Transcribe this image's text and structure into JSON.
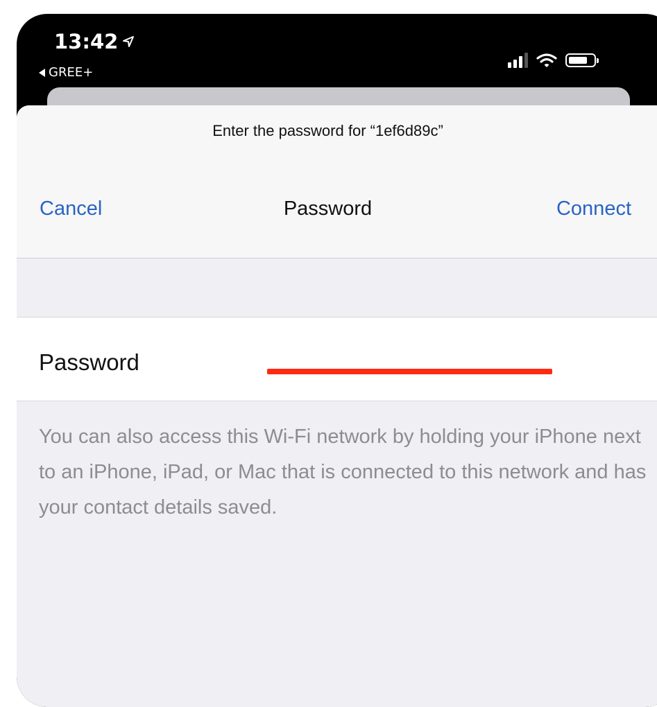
{
  "status_bar": {
    "time": "13:42",
    "location_glyph": "➤",
    "back_app": "GREE+"
  },
  "sheet": {
    "prompt": "Enter the password for “1ef6d89c”",
    "nav": {
      "cancel": "Cancel",
      "title": "Password",
      "connect": "Connect"
    },
    "password_row": {
      "label": "Password",
      "value_state": "redacted"
    },
    "footer": "You can also access this Wi-Fi network by holding your iPhone next to an iPhone, iPad, or Mac that is connected to this network and has your contact details saved."
  },
  "colors": {
    "accent": "#2a63c4",
    "redaction": "#ff2a12",
    "footer_text": "#8c8c93",
    "sheet_bg": "#efeff4"
  },
  "icons": [
    "location-arrow-icon",
    "back-triangle-icon",
    "cellular-signal-icon",
    "wifi-icon",
    "battery-icon"
  ]
}
